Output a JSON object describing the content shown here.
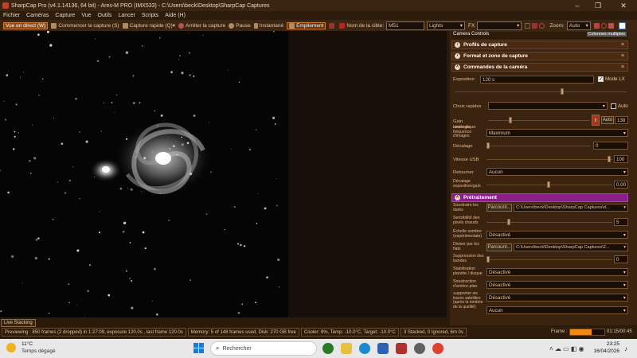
{
  "window": {
    "title": "SharpCap Pro (v4.1.14136, 64 bit) - Ares-M PRO (IMX533) - C:\\Users\\beck\\Desktop\\SharpCap Captures"
  },
  "menubar": [
    "Fichier",
    "Caméras",
    "Capture",
    "Vue",
    "Outils",
    "Lancer",
    "Scripts",
    "Aide (H)"
  ],
  "toolbar": {
    "live": "Vue en direct (W)",
    "start": "Commencer la capture (S)",
    "quick": "Capture rapide (Q)",
    "stop": "Arrêter la capture",
    "pause": "Pause",
    "snapshot": "Instantané",
    "stacking": "Empilement",
    "target_label": "Nom de la cible:",
    "target_value": "M51",
    "frame_type": "Lights",
    "fx_label": "FX",
    "zoom_label": "Zoom:",
    "zoom_value": "Auto"
  },
  "panel": {
    "header": "Camera Controls",
    "multi_columns": "Colonnes multiples",
    "sections": {
      "profiles": "Profils de capture",
      "format": "Format et zone de capture",
      "camera": "Commandes de la caméra",
      "preprocessing": "Prétraitement"
    },
    "camera": {
      "exposure_label": "Exposition",
      "exposure_value": "120 s",
      "lx_mode": "Mode LX",
      "quick_label": "Choix rapides",
      "auto_label": "Auto",
      "gain_label": "Gain analogique",
      "gain_auto": "Auto",
      "gain_value": "138",
      "fps_label": "Limite de fréquence d'images",
      "fps_value": "Maximum",
      "offset_label": "Décalage",
      "offset_value": "0",
      "usb_label": "Vitesse USB",
      "usb_value": "100",
      "flip_label": "Retourner",
      "flip_value": "Aucun",
      "expgain_label": "Décalage exposition/gain",
      "expgain_value": "0.00"
    },
    "pre": {
      "darks_label": "Soustraire les darks",
      "browse": "Parcourir...",
      "darks_path": "C:\\Users\\beck\\Desktop\\SharpCap Captures\\d...",
      "hotpix_label": "Sensibilité des pixels chauds",
      "hotpix_value": "5",
      "scale_label": "Échelle sombre (expérimentale)",
      "scale_value": "Désactivé",
      "flats_label": "Diviser par les flats",
      "flats_path": "C:\\Users\\beck\\Desktop\\SharpCap Captures\\2...",
      "banding_label": "Suppression des bandes",
      "banding_value": "0",
      "stab_label": "Stabilisation planète / disque",
      "stab_value": "Désactivé",
      "bg_label": "Soustraction d'arrière-plan",
      "bg_value": "Désactivé",
      "sat_label": "Supprimer les traces satellites (après la tombée de la qualité)",
      "sat_value": "Désactivé",
      "last_value": "Aucun"
    }
  },
  "live_stacking_tab": "Live Stacking",
  "status": {
    "preview": "Previewing : 850 frames (2 dropped) in 1:27:09, exposure 120.0s , last frame 120.0s",
    "memory": "Memory: 5 of 148 frames used, Disk: 270 GB free",
    "cooler": "Cooler: 9%, Temp: -10.0°C, Target: -10.0°C",
    "stacked": "3 Stacked, 0 Ignored, 6m 0s",
    "frame_label": "Frame :",
    "frame_time": "01:15/00:45",
    "frame_progress": 0.62
  },
  "taskbar": {
    "weather_temp": "11°C",
    "weather_desc": "Temps dégagé",
    "search": "Rechercher",
    "time": "23:25",
    "date": "16/04/2026"
  }
}
